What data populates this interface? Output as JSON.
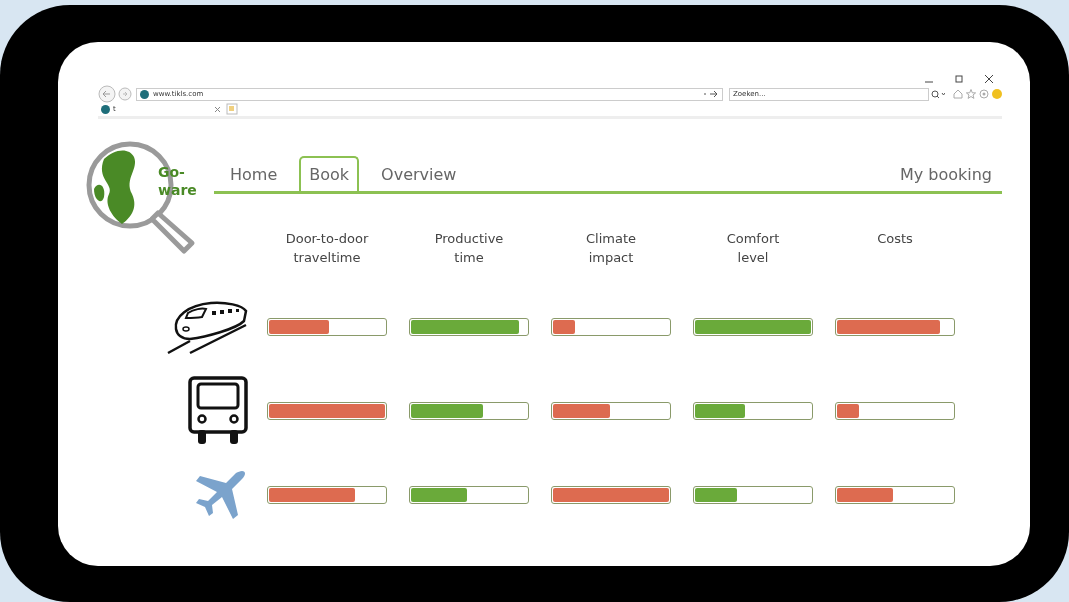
{
  "browser": {
    "url": "www.tikls.com",
    "search": {
      "placeholder": "Zoeken..."
    },
    "tab": {
      "title": "t"
    }
  },
  "logo": {
    "text": "Go-\nware"
  },
  "nav": [
    {
      "label": "Home",
      "selected": false
    },
    {
      "label": "Book",
      "selected": true
    },
    {
      "label": "Overview",
      "selected": false
    }
  ],
  "nav_right": {
    "label": "My booking"
  },
  "columns": [
    "Door-to-door\ntraveltime",
    "Productive\ntime",
    "Climate\nimpact",
    "Comfort\nlevel",
    "Costs"
  ],
  "rows": [
    {
      "kind": "train",
      "bars": [
        {
          "level": 0.52,
          "color": "#dd6b50"
        },
        {
          "level": 0.93,
          "color": "#6aaa3a"
        },
        {
          "level": 0.19,
          "color": "#dd6b50"
        },
        {
          "level": 1.0,
          "color": "#6aaa3a"
        },
        {
          "level": 0.89,
          "color": "#dd6b50"
        }
      ]
    },
    {
      "kind": "bus",
      "bars": [
        {
          "level": 1.0,
          "color": "#dd6b50"
        },
        {
          "level": 0.62,
          "color": "#6aaa3a"
        },
        {
          "level": 0.49,
          "color": "#dd6b50"
        },
        {
          "level": 0.43,
          "color": "#6aaa3a"
        },
        {
          "level": 0.19,
          "color": "#dd6b50"
        }
      ]
    },
    {
      "kind": "plane",
      "bars": [
        {
          "level": 0.74,
          "color": "#dd6b50"
        },
        {
          "level": 0.48,
          "color": "#6aaa3a"
        },
        {
          "level": 1.0,
          "color": "#dd6b50"
        },
        {
          "level": 0.36,
          "color": "#6aaa3a"
        },
        {
          "level": 0.48,
          "color": "#dd6b50"
        }
      ]
    }
  ]
}
